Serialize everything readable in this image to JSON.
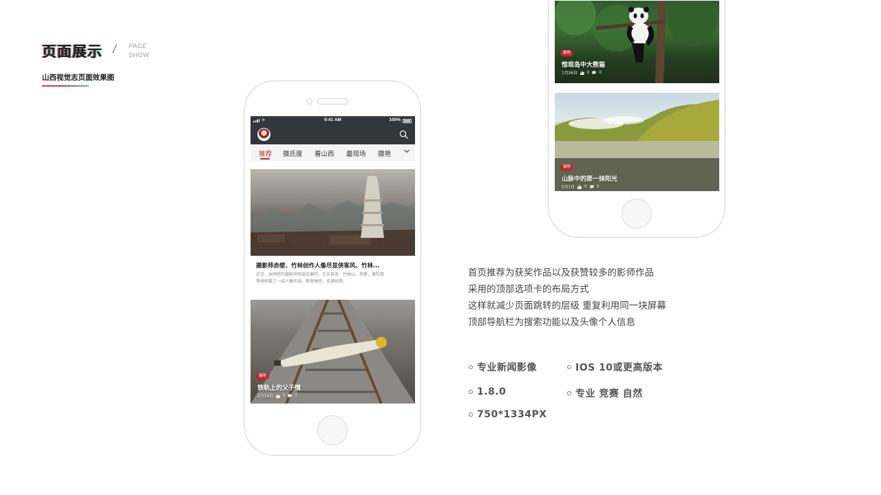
{
  "header": {
    "title": "页面展示",
    "en_line1": "PAGE",
    "en_line2": "SHOW",
    "subtitle": "山西视觉志页面效果图"
  },
  "phone1": {
    "status": {
      "time": "9:41 AM",
      "battery": "100%"
    },
    "tabs": [
      "推荐",
      "摄氏度",
      "看山西",
      "最现场",
      "摄艳"
    ],
    "active_tab": "推荐",
    "article1": {
      "title": "摄影师赤壁、竹林创作人像尽显侠客风、竹林...",
      "desc_line1": "近日，本网特约摄影师到湖北黄冈，在五祖寺、竹林山、赤壁，普陀观",
      "desc_line2": "等地拍摄了一组人像作品。新奇独特，充满创意。"
    },
    "article2": {
      "tag": "摄艳",
      "title": "铁轨上的父子情",
      "date": "2月14日",
      "likes": "0",
      "comments": "0"
    }
  },
  "phone2": {
    "article1": {
      "tag": "摄艳",
      "title": "惊现岛中大熊猫",
      "date": "1月26日",
      "likes": "0",
      "comments": "0"
    },
    "article2": {
      "tag": "摄艳",
      "title": "山脉中的那一抹阳光",
      "date": "5月1日",
      "likes": "0",
      "comments": "0"
    }
  },
  "description": [
    "首页推荐为获奖作品以及获赞较多的影师作品",
    "采用的顶部选项卡的布局方式",
    "这样就减少页面跳转的层级 重复利用同一块屏幕",
    "顶部导航栏为搜索功能以及头像个人信息"
  ],
  "features": {
    "f1": "专业新闻影像",
    "f2": "IOS 10或更高版本",
    "f3": "1.8.0",
    "f4": "专业 竞赛 自然",
    "f5": "750*1334PX"
  },
  "colors": {
    "accent_red": "#c8202a",
    "appbar": "#33373d",
    "tab_bg": "#f4f4f4"
  },
  "icons": [
    "search-icon",
    "chevron-down-icon",
    "thumb-up-icon",
    "comment-icon",
    "avatar",
    "signal-icon",
    "wifi-icon",
    "battery-icon"
  ]
}
